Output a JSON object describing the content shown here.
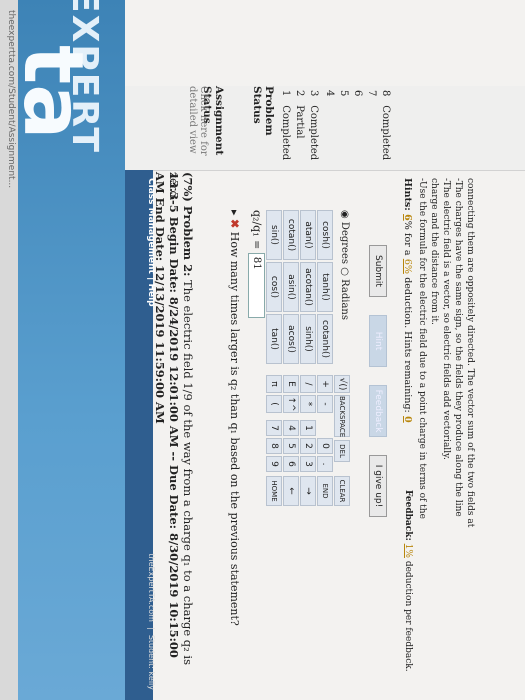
{
  "brand": {
    "logo_word": "EXPERT",
    "logo_mark": "ta",
    "site": "theExpertTA.com",
    "student": "Student: kelly"
  },
  "browser": {
    "url": "theexpertta.com/Student/Assignment..."
  },
  "nav": {
    "class_management": "Class Management",
    "separator": "|",
    "help": "Help"
  },
  "sidebar": {
    "assignment_status": "Assignment Status",
    "detail_link": "Click here for detailed view",
    "problem_status": "Problem Status",
    "problems": [
      {
        "num": "1",
        "status": "Completed"
      },
      {
        "num": "2",
        "status": "Partial"
      },
      {
        "num": "3",
        "status": "Completed"
      },
      {
        "num": "4",
        "status": ""
      },
      {
        "num": "5",
        "status": ""
      },
      {
        "num": "6",
        "status": ""
      },
      {
        "num": "7",
        "status": ""
      },
      {
        "num": "8",
        "status": "Completed"
      }
    ]
  },
  "assignment": {
    "header": "13.3-5 Begin Date: 8/24/2019 12:01:00 AM -- Due Date: 8/30/2019 10:15:00 AM End Date: 12/13/2019 11:59:00 AM",
    "problem_label": "(7%) Problem 2:",
    "problem_text": "The electric field 1/9 of the way from a charge q₁ to a charge q₂ is zero."
  },
  "question": {
    "text": "How many times larger is q₂ than q₁ based on the previous statement?",
    "answer_label": "q₂/q₁ =",
    "answer_value": "81"
  },
  "keypad": {
    "functions": [
      "sin()",
      "cos()",
      "tan()",
      "cotan()",
      "asin()",
      "acos()",
      "atan()",
      "acotan()",
      "sinh()",
      "cosh()",
      "tanh()",
      "cotanh()"
    ],
    "symbols": [
      "π",
      "(",
      "E",
      "↑^",
      "/",
      "*",
      "+",
      "-",
      "√()",
      "BACKSPACE"
    ],
    "digits": [
      "7",
      "8",
      "9",
      "4",
      "5",
      "6",
      "1",
      "2",
      "3",
      "0",
      "."
    ],
    "specials": [
      "HOME",
      "←",
      "→",
      "END",
      "DEL",
      "CLEAR"
    ],
    "degrees": "Degrees",
    "radians": "Radians"
  },
  "buttons": {
    "submit": "Submit",
    "hint": "Hint",
    "feedback": "Feedback",
    "give_up": "I give up!"
  },
  "hints_section": {
    "label": "Hints:",
    "hint_pct": "6",
    "text": "for a",
    "deduction_pct": "6%",
    "deduction_text": "deduction. Hints remaining:",
    "remaining": "0"
  },
  "feedback_section": {
    "label": "Feedback:",
    "pct": "1%",
    "text": "deduction per feedback."
  },
  "hint_lines": [
    "-Use the formula for the electric field due to a point charge in terms of the",
    "charge and the distance from it.",
    "-The electric field is a vector, so electric fields add vectorially.",
    "-The charges have the same sign, so the fields they produce along the line",
    "connecting them are oppositely directed. The vector sum of the two fields at"
  ]
}
